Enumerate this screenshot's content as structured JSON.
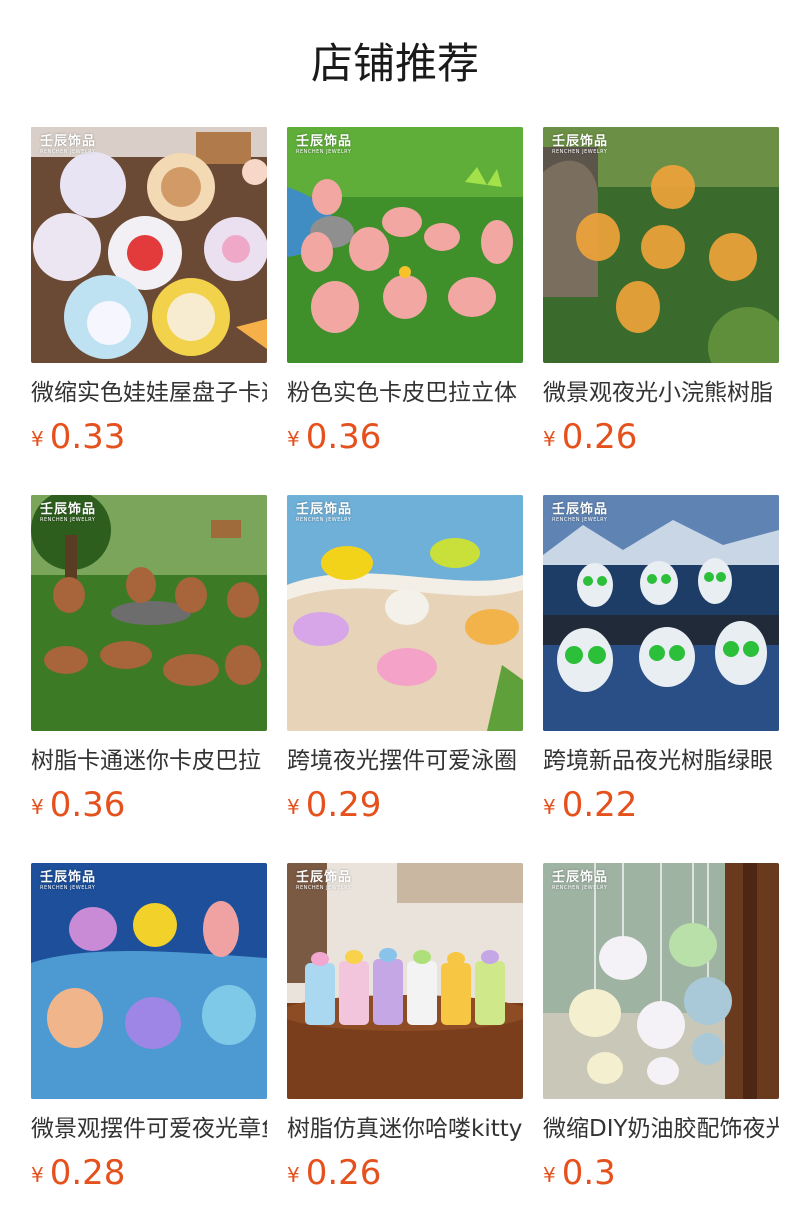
{
  "header": {
    "title": "店铺推荐"
  },
  "brand": {
    "name": "壬辰饰品",
    "sub": "RENCHEN JEWELRY"
  },
  "currency": "¥",
  "products": [
    {
      "name": "微缩实色娃娃屋盘子卡通",
      "price": "0.33",
      "scene": "plates"
    },
    {
      "name": "粉色实色卡皮巴拉立体",
      "price": "0.36",
      "scene": "pink-capybara"
    },
    {
      "name": "微景观夜光小浣熊树脂",
      "price": "0.26",
      "scene": "glow-raccoon"
    },
    {
      "name": "树脂卡通迷你卡皮巴拉",
      "price": "0.36",
      "scene": "brown-capybara"
    },
    {
      "name": "跨境夜光摆件可爱泳圈",
      "price": "0.29",
      "scene": "swim-rings"
    },
    {
      "name": "跨境新品夜光树脂绿眼",
      "price": "0.22",
      "scene": "glow-aliens"
    },
    {
      "name": "微景观摆件可爱夜光章鱼",
      "price": "0.28",
      "scene": "octopus"
    },
    {
      "name": "树脂仿真迷你哈喽kitty",
      "price": "0.26",
      "scene": "bottles"
    },
    {
      "name": "微缩DIY奶油胶配饰夜光",
      "price": "0.3",
      "scene": "bears"
    }
  ]
}
